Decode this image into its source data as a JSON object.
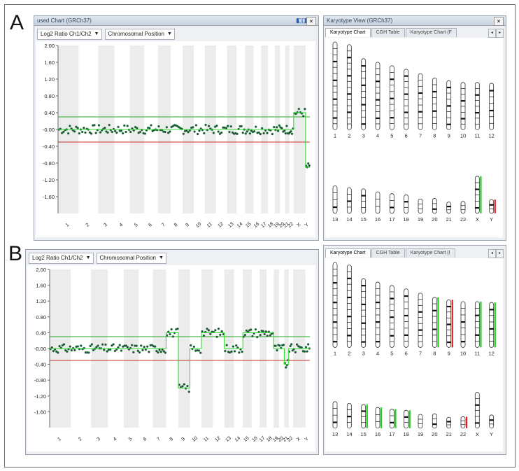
{
  "panel_a": {
    "letter": "A",
    "chart_window_title": "used Chart (GRCh37)",
    "karyotype_window_title": "Karyotype View (GRCh37)",
    "close_label": "×",
    "dock_icon": "dock-icon",
    "ratio_dropdown": "Log2 Ratio Ch1/Ch2",
    "position_dropdown": "Chromosomal Position",
    "tabs": [
      "Karyotype Chart",
      "CGH Table",
      "Karyotype Chart (F"
    ],
    "tab_prev": "◂",
    "tab_next": "▸"
  },
  "panel_b": {
    "letter": "B",
    "ratio_dropdown": "Log2 Ratio Ch1/Ch2",
    "position_dropdown": "Chromosomal Position",
    "tabs": [
      "Karyotype Chart",
      "CGH Table",
      "Karyotype Chart (I"
    ],
    "tab_prev": "◂",
    "tab_next": "▸"
  },
  "chromosomes": [
    "1",
    "2",
    "3",
    "4",
    "5",
    "6",
    "7",
    "8",
    "9",
    "10",
    "11",
    "12",
    "13",
    "14",
    "15",
    "16",
    "17",
    "18",
    "19",
    "20",
    "21",
    "22",
    "X",
    "Y"
  ],
  "karyotype_colors": {
    "gain": "#22cc22",
    "loss": "#dd2222"
  },
  "karyotype_a": {
    "gain": [
      "X"
    ],
    "loss": [
      "Y"
    ]
  },
  "karyotype_b": {
    "gain": [
      "8",
      "11",
      "12",
      "15",
      "16",
      "17",
      "18"
    ],
    "loss": [
      "9",
      "22"
    ]
  },
  "chart_data": [
    {
      "type": "scatter",
      "ylabel": "",
      "yticks": [
        "2.00",
        "1.60",
        "1.20",
        "0.80",
        "0.40",
        "-0.00",
        "-0.40",
        "-0.80",
        "-1.20",
        "-1.60"
      ],
      "ylim": [
        -2.0,
        2.0
      ],
      "threshold_gain": 0.3,
      "threshold_loss": -0.3,
      "categories": [
        "1",
        "2",
        "3",
        "4",
        "5",
        "6",
        "7",
        "8",
        "9",
        "10",
        "11",
        "12",
        "13",
        "14",
        "15",
        "16",
        "17",
        "18",
        "19",
        "20",
        "21",
        "22",
        "X",
        "Y"
      ],
      "series": [
        {
          "values": [
            0.0,
            0.0,
            0.0,
            0.0,
            0.0,
            0.0,
            0.0,
            0.0,
            0.0,
            0.0,
            0.0,
            0.0,
            0.0,
            0.0,
            0.0,
            0.0,
            0.0,
            0.0,
            0.0,
            0.0,
            0.0,
            0.0,
            0.4,
            -0.9
          ]
        }
      ],
      "grid": "alternating chromosome bands"
    },
    {
      "type": "scatter",
      "ylabel": "",
      "yticks": [
        "2.00",
        "1.60",
        "1.20",
        "0.80",
        "0.40",
        "-0.00",
        "-0.40",
        "-0.80",
        "-1.20",
        "-1.60"
      ],
      "ylim": [
        -2.0,
        2.0
      ],
      "threshold_gain": 0.3,
      "threshold_loss": -0.3,
      "categories": [
        "1",
        "2",
        "3",
        "4",
        "5",
        "6",
        "7",
        "8",
        "9",
        "10",
        "11",
        "12",
        "13",
        "14",
        "15",
        "16",
        "17",
        "18",
        "19",
        "20",
        "21",
        "22",
        "X",
        "Y"
      ],
      "series": [
        {
          "values": [
            0.0,
            0.0,
            0.0,
            0.0,
            0.0,
            0.0,
            0.0,
            0.4,
            -1.0,
            0.0,
            0.4,
            0.4,
            0.0,
            0.0,
            0.4,
            0.4,
            0.4,
            0.4,
            0.0,
            0.0,
            -0.4,
            0.0,
            0.0,
            0.0
          ]
        }
      ],
      "grid": "alternating chromosome bands"
    }
  ]
}
